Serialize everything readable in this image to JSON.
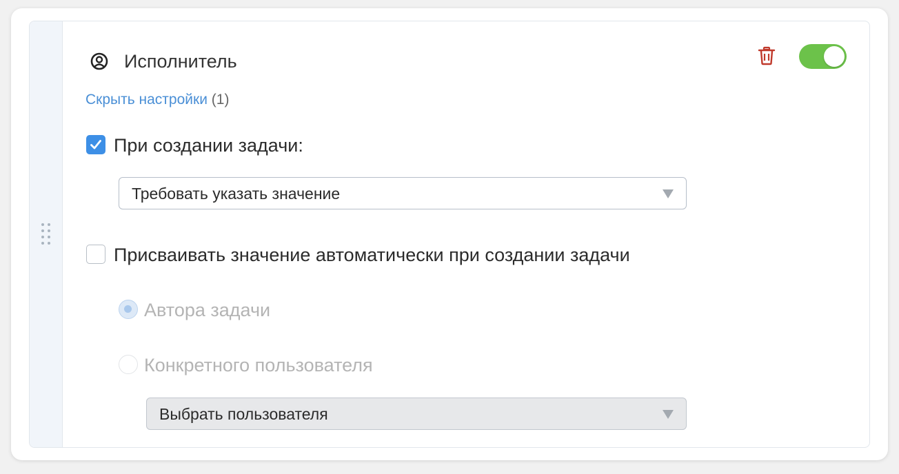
{
  "field": {
    "title": "Исполнитель",
    "icon": "user-circle-icon",
    "enabled": true,
    "toggle_color": "#6cc24a",
    "delete_icon": "trash-icon",
    "delete_color": "#c0392b"
  },
  "settings_link": {
    "label": "Скрыть настройки",
    "count": "(1)",
    "color": "#4a8fd6"
  },
  "on_create": {
    "label": "При создании задачи:",
    "checked": true,
    "select": {
      "value": "Требовать указать значение"
    }
  },
  "auto_assign": {
    "label": "Присваивать значение автоматически при создании задачи",
    "checked": false,
    "options": [
      {
        "label": "Автора задачи",
        "selected": true
      },
      {
        "label": "Конкретного пользователя",
        "selected": false
      }
    ],
    "user_select": {
      "value": "Выбрать пользователя",
      "disabled": true
    }
  }
}
